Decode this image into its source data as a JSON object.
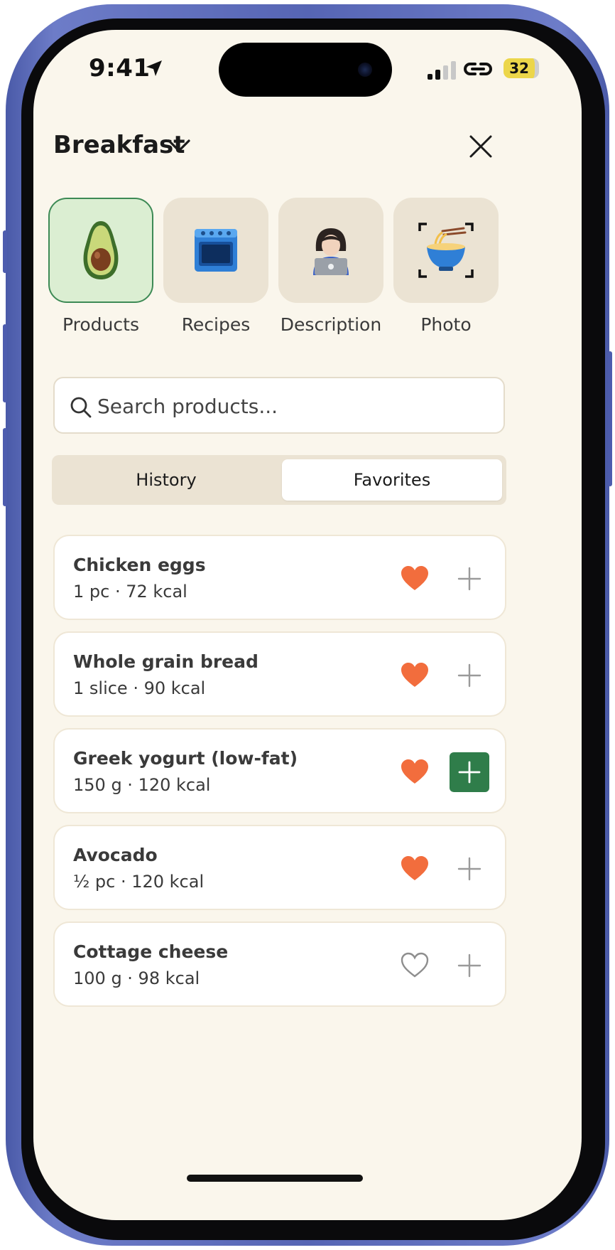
{
  "status": {
    "time": "9:41",
    "battery": "32"
  },
  "header": {
    "title": "Breakfast"
  },
  "modes": [
    {
      "label": "Products",
      "icon": "avocado-emoji",
      "active": true
    },
    {
      "label": "Recipes",
      "icon": "oven-emoji",
      "active": false
    },
    {
      "label": "Description",
      "icon": "person-laptop-emoji",
      "active": false
    },
    {
      "label": "Photo",
      "icon": "noodle-bowl-scan-emoji",
      "active": false
    }
  ],
  "search": {
    "placeholder": "Search products..."
  },
  "tabs": {
    "history": "History",
    "favorites": "Favorites",
    "selected": "Favorites"
  },
  "items": [
    {
      "name": "Chicken eggs",
      "meta": "1 pc · 72 kcal",
      "favorite": true,
      "add_primary": false
    },
    {
      "name": "Whole grain bread",
      "meta": "1 slice · 90 kcal",
      "favorite": true,
      "add_primary": false
    },
    {
      "name": "Greek yogurt (low-fat)",
      "meta": "150 g · 120 kcal",
      "favorite": true,
      "add_primary": true
    },
    {
      "name": "Avocado",
      "meta": "½ pc · 120 kcal",
      "favorite": true,
      "add_primary": false
    },
    {
      "name": "Cottage cheese",
      "meta": "100 g · 98 kcal",
      "favorite": false,
      "add_primary": false
    }
  ],
  "colors": {
    "background": "#faf6ec",
    "accent_green": "#2f7d4a",
    "heart_orange": "#f26d3d",
    "tile_beige": "#ebe3d3",
    "active_tile": "#dbeed2"
  }
}
